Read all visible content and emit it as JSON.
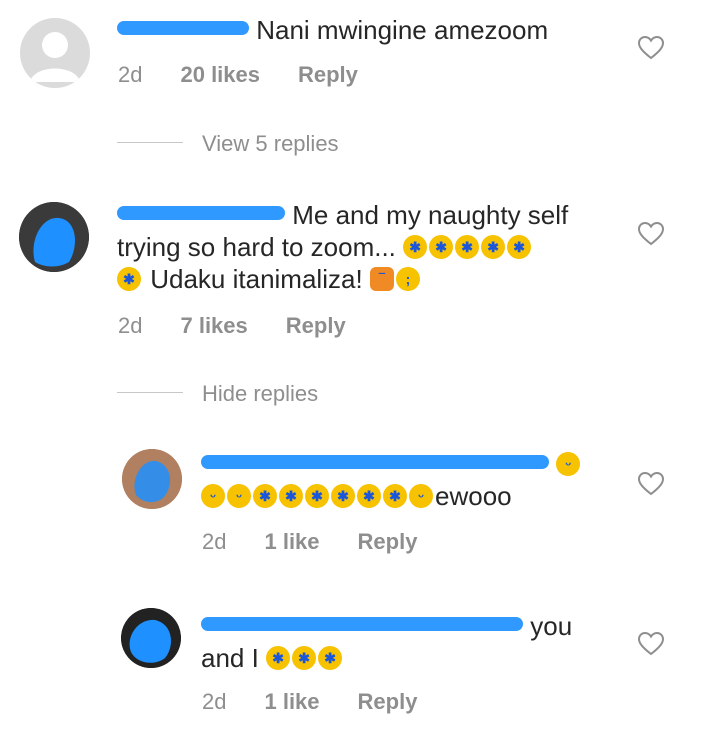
{
  "comments": [
    {
      "text": "Nani mwingine amezoom",
      "time": "2d",
      "likes": "20 likes",
      "reply": "Reply"
    },
    {
      "line1": "Me and my naughty self",
      "line2": "trying so hard to zoom...",
      "line3": "Udaku itanimaliza!",
      "time": "2d",
      "likes": "7 likes",
      "reply": "Reply"
    }
  ],
  "view_replies": "View 5 replies",
  "hide_replies": "Hide replies",
  "replies": [
    {
      "tail": "ewooo",
      "time": "2d",
      "likes": "1 like",
      "reply": "Reply"
    },
    {
      "line1_tail": "you",
      "line2": "and I",
      "time": "2d",
      "likes": "1 like",
      "reply": "Reply"
    }
  ],
  "icons": {
    "like": "heart-outline-icon",
    "emoji_laugh_cry": "rolling-on-floor-laughing-emoji",
    "emoji_grin": "grinning-squinting-emoji",
    "emoji_shrug": "person-shrugging-emoji",
    "emoji_wink": "winking-tongue-emoji",
    "emoji_giggle": "hand-over-mouth-emoji"
  },
  "colors": {
    "text": "#262626",
    "meta": "#8e8e8e",
    "redaction": "#1e90ff"
  }
}
